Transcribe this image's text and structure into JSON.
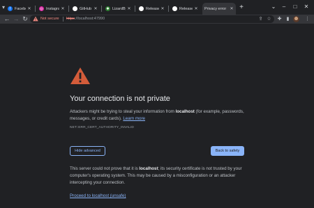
{
  "tabs": [
    {
      "title": "Facebook",
      "icon": "facebook-icon",
      "color": "#1877f2",
      "glyph": "f"
    },
    {
      "title": "Instagram",
      "icon": "instagram-icon",
      "color": "#d6249f",
      "glyph": "◎"
    },
    {
      "title": "GitHub",
      "icon": "github-icon",
      "color": "#ffffff",
      "glyph": "●"
    },
    {
      "title": "LizardByte",
      "icon": "lizard-icon",
      "color": "#4caf50",
      "glyph": "✱"
    },
    {
      "title": "Release",
      "icon": "github-icon",
      "color": "#ffffff",
      "glyph": "●"
    },
    {
      "title": "Release",
      "icon": "github-icon",
      "color": "#ffffff",
      "glyph": "●"
    },
    {
      "title": "Privacy error",
      "icon": "warning-icon",
      "color": "#f28b82",
      "glyph": ""
    }
  ],
  "active_tab_index": 6,
  "toolbar": {
    "not_secure": "Not secure",
    "url_scheme": "https",
    "url_rest": "://localhost:47990"
  },
  "page": {
    "heading": "Your connection is not private",
    "para1_a": "Attackers might be trying to steal your information from ",
    "para1_host": "localhost",
    "para1_b": " (for example, passwords, messages, or credit cards). ",
    "learn_more": "Learn more",
    "error_code": "NET::ERR_CERT_AUTHORITY_INVALID",
    "hide_advanced": "Hide advanced",
    "back_to_safety": "Back to safety",
    "para2_a": "This server could not prove that it is ",
    "para2_host": "localhost",
    "para2_b": "; its security certificate is not trusted by your computer's operating system. This may be caused by a misconfiguration or an attacker intercepting your connection.",
    "proceed_link": "Proceed to localhost (unsafe)"
  },
  "colors": {
    "warning": "#d45c3a",
    "accent": "#8ab4f8",
    "page_bg": "#202124"
  }
}
